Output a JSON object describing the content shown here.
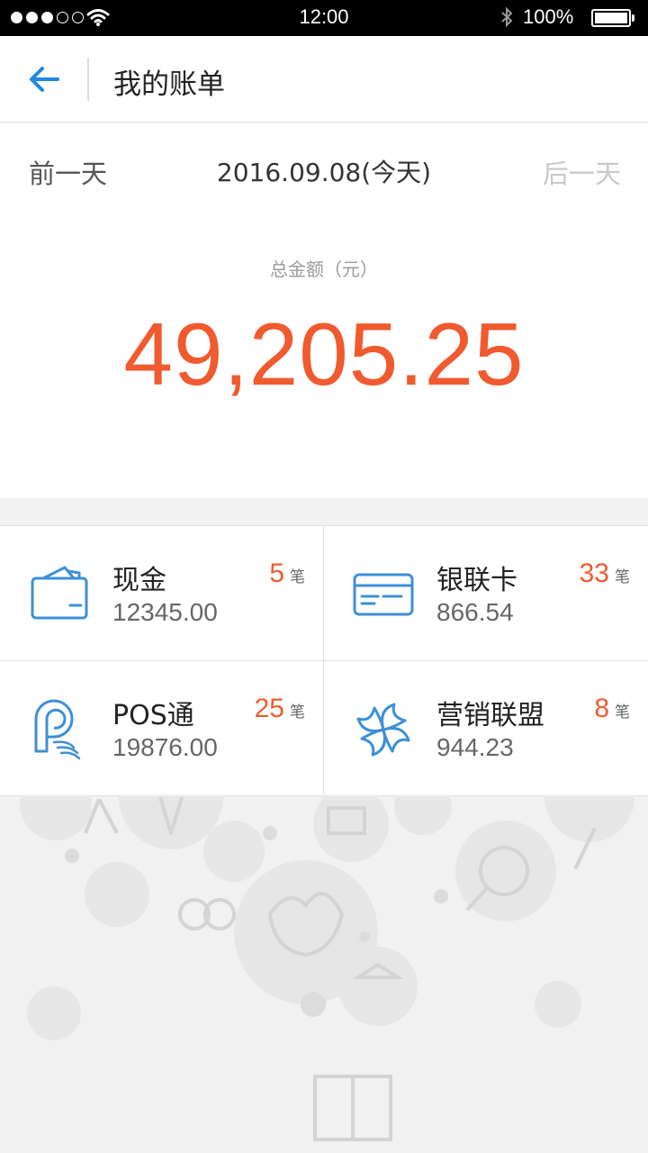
{
  "status_bar": {
    "time": "12:00",
    "battery": "100%"
  },
  "header": {
    "title": "我的账单"
  },
  "day_nav": {
    "prev": "前一天",
    "date": "2016.09.08(今天)",
    "next": "后一天"
  },
  "summary": {
    "label": "总金额（元）",
    "amount": "49,205.25"
  },
  "accounts": [
    {
      "name": "现金",
      "amount": "12345.00",
      "count": "5",
      "unit": "笔",
      "icon": "wallet-icon"
    },
    {
      "name": "银联卡",
      "amount": "866.54",
      "count": "33",
      "unit": "笔",
      "icon": "bank-card-icon"
    },
    {
      "name": "POS通",
      "amount": "19876.00",
      "count": "25",
      "unit": "笔",
      "icon": "pos-icon"
    },
    {
      "name": "营销联盟",
      "amount": "944.23",
      "count": "8",
      "unit": "笔",
      "icon": "pinwheel-icon"
    }
  ],
  "colors": {
    "accent": "#1e88e5",
    "amount": "#f05a2e",
    "icon": "#3d8fd8"
  }
}
